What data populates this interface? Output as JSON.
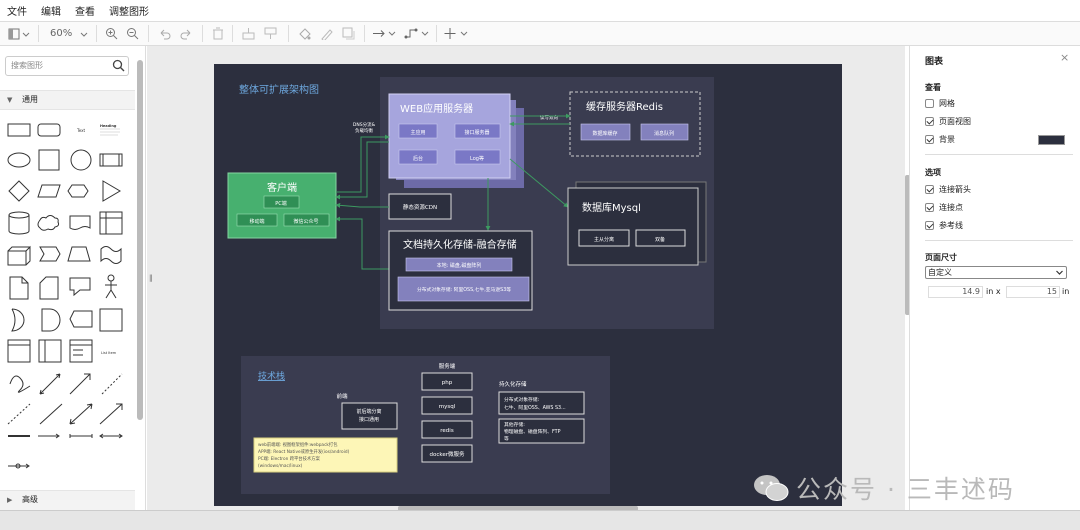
{
  "menu": [
    "文件",
    "编辑",
    "查看",
    "调整图形"
  ],
  "toolbar": {
    "zoom": "60%"
  },
  "left_panel": {
    "search_placeholder": "搜索图形",
    "section_general": "通用",
    "section_advanced": "高级",
    "shape_labels": {
      "text": "Text",
      "heading": "Heading",
      "list_item": "List Item"
    }
  },
  "right_panel": {
    "title": "图表",
    "view_heading": "查看",
    "grid": "网格",
    "grid_checked": false,
    "page_view": "页面视图",
    "page_view_checked": true,
    "background": "背景",
    "background_checked": true,
    "background_color": "#2c2f3e",
    "options_heading": "选项",
    "connection_arrows": "连接箭头",
    "connection_points": "连接点",
    "guides": "参考线",
    "page_size_heading": "页面尺寸",
    "page_size_option": "自定义",
    "width_value": "14.9",
    "width_unit": "in x",
    "height_value": "15",
    "height_unit": "in"
  },
  "diagram": {
    "title": "整体可扩展架构图",
    "web_server": "WEB应用服务器",
    "web_items": [
      "主应用",
      "接口服务器",
      "后台",
      "Log等"
    ],
    "cache": "缓存服务器Redis",
    "cache_items": [
      "数据库缓存",
      "消息队列"
    ],
    "client": "客户端",
    "client_items": [
      "PC端",
      "移动端",
      "微信公众号"
    ],
    "cdn": "静态资源CDN",
    "dns_label": "DNS分流&\n负载均衡",
    "rw_label": "读写双向",
    "storage": "文档持久化存储-融合存储",
    "storage_items": [
      "本地: 磁盘,磁盘阵列",
      "分布式对象存储: 阿里OSS,七牛,亚马逊S3等"
    ],
    "mysql": "数据库Mysql",
    "mysql_items": [
      "主从分离",
      "双备"
    ],
    "tech_title": "技术栈",
    "frontend_label": "前端",
    "frontend_box": "前后端分离\n接口通用",
    "frontend_note": "web前端端: 视图框架组件:webpack打包\nAPP端: React Native或原生开发(ios/android)\nPC端: Electron 跨平台技术方案\n(windows/mac/linux)",
    "server_label": "服务端",
    "server_items": [
      "php",
      "mysql",
      "redis",
      "docker微服务"
    ],
    "persist_label": "持久化存储",
    "persist_items": [
      "分布式对象存储:\n七牛、阿里OSS、AWS S3...",
      "其他存储:\n物理磁盘、磁盘阵列、FTP\n等"
    ]
  },
  "watermark": "公众号 · 三丰述码"
}
